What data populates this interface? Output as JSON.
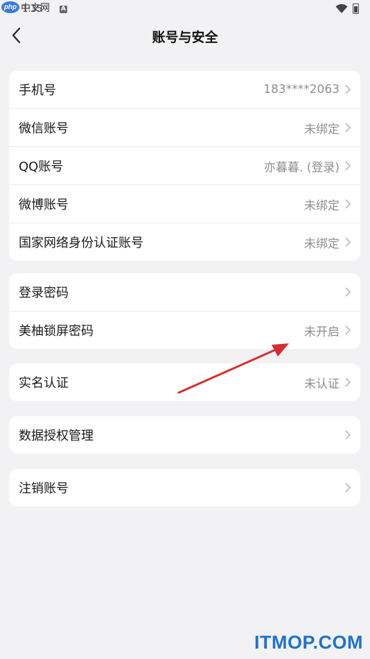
{
  "status_bar": {
    "time": "1:35",
    "watermark_php": "php",
    "watermark_cn": "中文网",
    "indicator": "A"
  },
  "header": {
    "title": "账号与安全"
  },
  "groups": [
    {
      "rows": [
        {
          "label": "手机号",
          "value": "183****2063"
        },
        {
          "label": "微信账号",
          "value": "未绑定"
        },
        {
          "label": "QQ账号",
          "value": "亦暮暮. (登录)"
        },
        {
          "label": "微博账号",
          "value": "未绑定"
        },
        {
          "label": "国家网络身份认证账号",
          "value": "未绑定"
        }
      ]
    },
    {
      "rows": [
        {
          "label": "登录密码",
          "value": ""
        },
        {
          "label": "美柚锁屏密码",
          "value": "未开启"
        }
      ]
    },
    {
      "rows": [
        {
          "label": "实名认证",
          "value": "未认证"
        }
      ]
    },
    {
      "rows": [
        {
          "label": "数据授权管理",
          "value": ""
        }
      ]
    },
    {
      "rows": [
        {
          "label": "注销账号",
          "value": ""
        }
      ]
    }
  ],
  "watermark": "ITMOP.COM",
  "colors": {
    "background": "#f2f2f4",
    "annotation_arrow": "#d32f2f",
    "watermark": "#1f72c8"
  }
}
